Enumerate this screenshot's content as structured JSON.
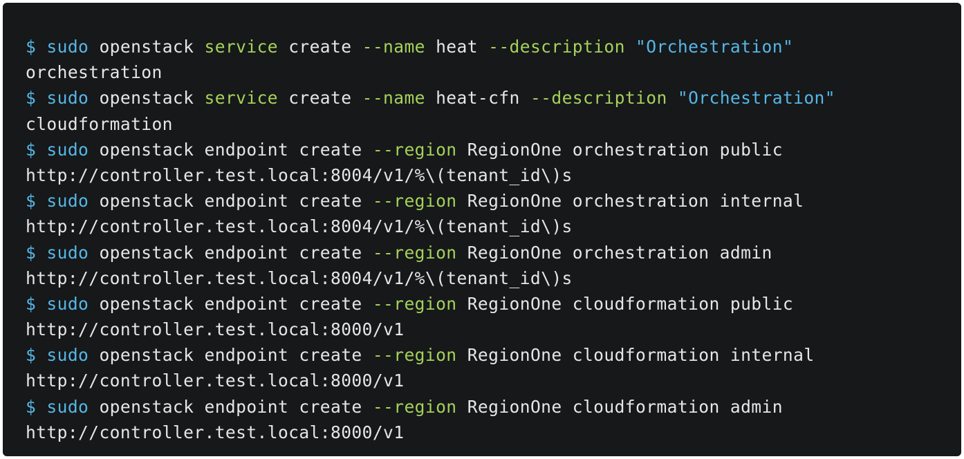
{
  "colors": {
    "background": "#16181a",
    "text": "#e6e6e6",
    "prompt": "#56b6e6",
    "keyword": "#a6d15a",
    "string": "#56b6e6"
  },
  "code_block": {
    "lines": [
      {
        "tokens": [
          {
            "text": "$ ",
            "style": "prompt"
          },
          {
            "text": "sudo",
            "style": "sudo"
          },
          {
            "text": " openstack ",
            "style": "plain"
          },
          {
            "text": "service",
            "style": "kw"
          },
          {
            "text": " create ",
            "style": "plain"
          },
          {
            "text": "--name",
            "style": "kw"
          },
          {
            "text": " heat ",
            "style": "plain"
          },
          {
            "text": "--description",
            "style": "kw"
          },
          {
            "text": " ",
            "style": "plain"
          },
          {
            "text": "\"Orchestration\"",
            "style": "str"
          }
        ]
      },
      {
        "tokens": [
          {
            "text": "orchestration",
            "style": "plain"
          }
        ]
      },
      {
        "tokens": [
          {
            "text": "$ ",
            "style": "prompt"
          },
          {
            "text": "sudo",
            "style": "sudo"
          },
          {
            "text": " openstack ",
            "style": "plain"
          },
          {
            "text": "service",
            "style": "kw"
          },
          {
            "text": " create ",
            "style": "plain"
          },
          {
            "text": "--name",
            "style": "kw"
          },
          {
            "text": " heat-cfn ",
            "style": "plain"
          },
          {
            "text": "--description",
            "style": "kw"
          },
          {
            "text": " ",
            "style": "plain"
          },
          {
            "text": "\"Orchestration\"",
            "style": "str"
          }
        ]
      },
      {
        "tokens": [
          {
            "text": "cloudformation",
            "style": "plain"
          }
        ]
      },
      {
        "tokens": [
          {
            "text": "$ ",
            "style": "prompt"
          },
          {
            "text": "sudo",
            "style": "sudo"
          },
          {
            "text": " openstack endpoint create ",
            "style": "plain"
          },
          {
            "text": "--region",
            "style": "kw"
          },
          {
            "text": " RegionOne orchestration public",
            "style": "plain"
          }
        ]
      },
      {
        "tokens": [
          {
            "text": "http://controller.test.local:8004/v1/%\\(tenant_id\\)s",
            "style": "plain"
          }
        ]
      },
      {
        "tokens": [
          {
            "text": "$ ",
            "style": "prompt"
          },
          {
            "text": "sudo",
            "style": "sudo"
          },
          {
            "text": " openstack endpoint create ",
            "style": "plain"
          },
          {
            "text": "--region",
            "style": "kw"
          },
          {
            "text": " RegionOne orchestration internal",
            "style": "plain"
          }
        ]
      },
      {
        "tokens": [
          {
            "text": "http://controller.test.local:8004/v1/%\\(tenant_id\\)s",
            "style": "plain"
          }
        ]
      },
      {
        "tokens": [
          {
            "text": "$ ",
            "style": "prompt"
          },
          {
            "text": "sudo",
            "style": "sudo"
          },
          {
            "text": " openstack endpoint create ",
            "style": "plain"
          },
          {
            "text": "--region",
            "style": "kw"
          },
          {
            "text": " RegionOne orchestration admin",
            "style": "plain"
          }
        ]
      },
      {
        "tokens": [
          {
            "text": "http://controller.test.local:8004/v1/%\\(tenant_id\\)s",
            "style": "plain"
          }
        ]
      },
      {
        "tokens": [
          {
            "text": "$ ",
            "style": "prompt"
          },
          {
            "text": "sudo",
            "style": "sudo"
          },
          {
            "text": " openstack endpoint create ",
            "style": "plain"
          },
          {
            "text": "--region",
            "style": "kw"
          },
          {
            "text": " RegionOne cloudformation public",
            "style": "plain"
          }
        ]
      },
      {
        "tokens": [
          {
            "text": "http://controller.test.local:8000/v1",
            "style": "plain"
          }
        ]
      },
      {
        "tokens": [
          {
            "text": "$ ",
            "style": "prompt"
          },
          {
            "text": "sudo",
            "style": "sudo"
          },
          {
            "text": " openstack endpoint create ",
            "style": "plain"
          },
          {
            "text": "--region",
            "style": "kw"
          },
          {
            "text": " RegionOne cloudformation internal",
            "style": "plain"
          }
        ]
      },
      {
        "tokens": [
          {
            "text": "http://controller.test.local:8000/v1",
            "style": "plain"
          }
        ]
      },
      {
        "tokens": [
          {
            "text": "$ ",
            "style": "prompt"
          },
          {
            "text": "sudo",
            "style": "sudo"
          },
          {
            "text": " openstack endpoint create ",
            "style": "plain"
          },
          {
            "text": "--region",
            "style": "kw"
          },
          {
            "text": " RegionOne cloudformation admin",
            "style": "plain"
          }
        ]
      },
      {
        "tokens": [
          {
            "text": "http://controller.test.local:8000/v1",
            "style": "plain"
          }
        ]
      }
    ]
  }
}
